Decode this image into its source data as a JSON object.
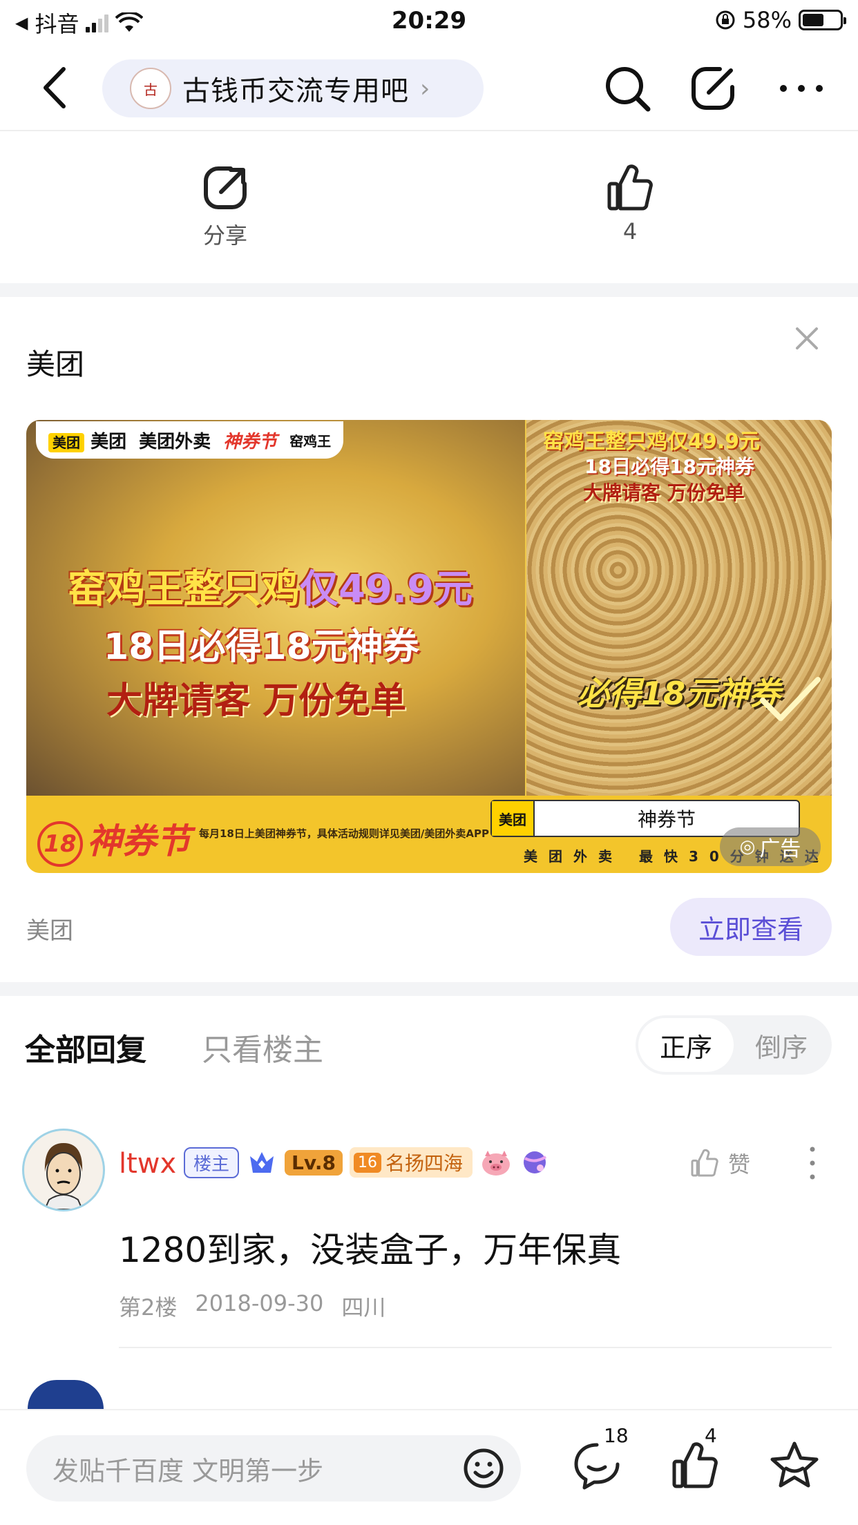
{
  "status_bar": {
    "carrier": "抖音",
    "time": "20:29",
    "battery": "58%",
    "battery_level": 0.58
  },
  "nav": {
    "forum_name": "古钱币交流专用吧",
    "forum_chevron": "›"
  },
  "post_actions": {
    "share_label": "分享",
    "like_count": "4"
  },
  "ad": {
    "advertiser": "美团",
    "banner": {
      "brand_meituan": "美团",
      "brand_waimai": "美团外卖",
      "brand_festival": "神券节",
      "brand_partner": "窑鸡王",
      "headline_main": "窑鸡王整只鸡",
      "headline_price": "仅49.9元",
      "line2": "18日必得18元神券",
      "line3": "大牌请客 万份免单",
      "right_line1": "窑鸡王整只鸡仅49.9元",
      "right_line2": "18日必得18元神券",
      "right_line3": "大牌请客 万份免单",
      "coupon_text": "必得18元神券",
      "logo_num": "18",
      "logo_text": "神券节",
      "fine_print": "每月18日上美团神券节，具体活动规则详见美团/美团外卖APP",
      "search_brand": "美团",
      "search_keyword": "神券节",
      "slogan": "美团外卖 最快30分钟送达"
    },
    "ad_tag": "广告",
    "source": "美团",
    "cta": "立即查看"
  },
  "replies": {
    "tab_all": "全部回复",
    "tab_op_only": "只看楼主",
    "sort_asc": "正序",
    "sort_desc": "倒序",
    "items": [
      {
        "username": "ltwx",
        "badge_op": "楼主",
        "level": "Lv.8",
        "title_num": "16",
        "title": "名扬四海",
        "like_label": "赞",
        "text": "1280到家，没装盒子，万年保真",
        "floor": "第2楼",
        "date": "2018-09-30",
        "location": "四川"
      }
    ]
  },
  "bottom_bar": {
    "composer_placeholder": "发贴千百度 文明第一步",
    "comment_count": "18",
    "like_count": "4"
  },
  "colors": {
    "accent": "#5b4fd6",
    "username": "#e3372c",
    "cta_bg": "#ece9fb",
    "banner_yellow": "#f3c52b"
  },
  "icons": [
    "back-icon",
    "search-icon",
    "edit-icon",
    "more-icon",
    "share-icon",
    "like-icon",
    "close-icon",
    "thumb-icon",
    "emoji-icon",
    "comment-icon",
    "star-icon",
    "crown-icon",
    "pig-icon"
  ]
}
